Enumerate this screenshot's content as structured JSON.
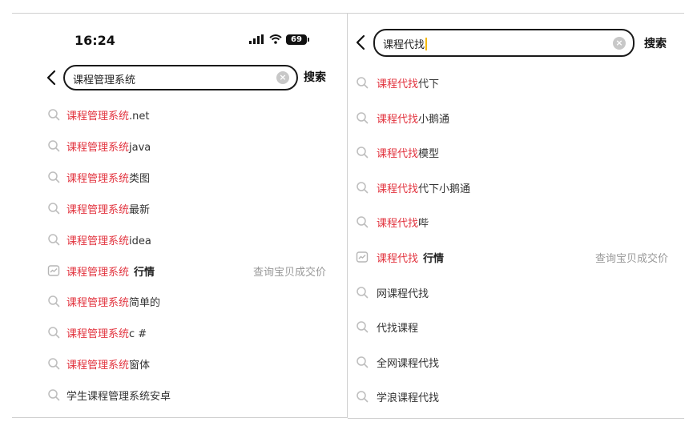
{
  "left": {
    "status": {
      "time": "16:24",
      "battery": "69"
    },
    "search": {
      "query": "课程管理系统",
      "button": "搜索"
    },
    "suggestions": [
      {
        "hl": "课程管理系统",
        "rest": ".net",
        "icon": "search-icon"
      },
      {
        "hl": "课程管理系统",
        "rest": "java",
        "icon": "search-icon"
      },
      {
        "hl": "课程管理系统",
        "rest": "类图",
        "icon": "search-icon"
      },
      {
        "hl": "课程管理系统",
        "rest": "最新",
        "icon": "search-icon"
      },
      {
        "hl": "课程管理系统",
        "rest": "idea",
        "icon": "search-icon"
      },
      {
        "hl": "课程管理系统",
        "tag": "行情",
        "right": "查询宝贝成交价",
        "icon": "trend-icon"
      },
      {
        "hl": "课程管理系统",
        "rest": "简单的",
        "icon": "search-icon"
      },
      {
        "hl": "课程管理系统",
        "rest": "c #",
        "icon": "search-icon"
      },
      {
        "hl": "课程管理系统",
        "rest": "窗体",
        "icon": "search-icon"
      },
      {
        "hl": "",
        "rest": "学生课程管理系统安卓",
        "icon": "search-icon"
      }
    ]
  },
  "right": {
    "search": {
      "query": "课程代找",
      "button": "搜索"
    },
    "suggestions": [
      {
        "hl": "课程代找",
        "rest": "代下",
        "icon": "search-icon"
      },
      {
        "hl": "课程代找",
        "rest": "小鹅通",
        "icon": "search-icon"
      },
      {
        "hl": "课程代找",
        "rest": "模型",
        "icon": "search-icon"
      },
      {
        "hl": "课程代找",
        "rest": "代下小鹅通",
        "icon": "search-icon"
      },
      {
        "hl": "课程代找",
        "rest": "哔",
        "icon": "search-icon"
      },
      {
        "hl": "课程代找",
        "tag": "行情",
        "right": "查询宝贝成交价",
        "icon": "trend-icon"
      },
      {
        "hl": "",
        "rest": "网课程代找",
        "icon": "search-icon"
      },
      {
        "hl": "",
        "rest": "代找课程",
        "icon": "search-icon"
      },
      {
        "hl": "",
        "rest": "全网课程代找",
        "icon": "search-icon"
      },
      {
        "hl": "",
        "rest": "学浪课程代找",
        "icon": "search-icon"
      }
    ]
  },
  "colors": {
    "highlight": "#e2343f",
    "secondary": "#999999",
    "border": "#1a1a1a",
    "caret": "#f5b800"
  }
}
